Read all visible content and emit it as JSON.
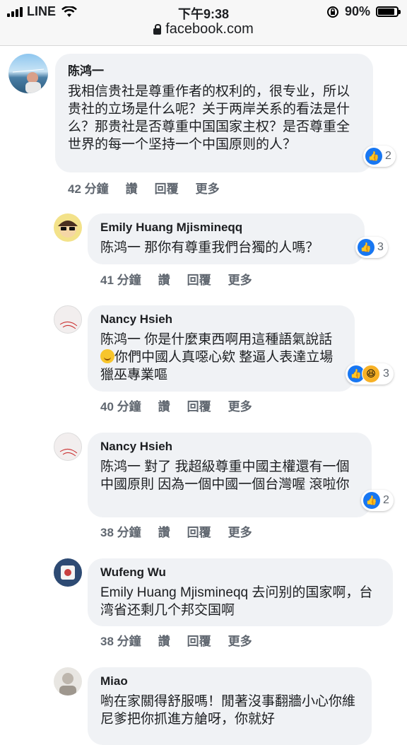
{
  "status_bar": {
    "carrier": "LINE",
    "time": "下午9:38",
    "battery": "90%",
    "battery_level": 0.9,
    "url": "facebook.com"
  },
  "comments": [
    {
      "name": "陈鸿一",
      "text": "我相信贵社是尊重作者的权利的，很专业，所以贵社的立场是什么呢？关于两岸关系的看法是什么？那贵社是否尊重中国国家主权？是否尊重全世界的每一个坚持一个中国原则的人？",
      "time": "42 分鐘",
      "actions": [
        "讚",
        "回覆",
        "更多"
      ],
      "reaction_count": "2"
    },
    {
      "name": "Emily Huang Mjismineqq",
      "text": "陈鸿一 那你有尊重我們台獨的人嗎？",
      "time": "41 分鐘",
      "actions": [
        "讚",
        "回覆",
        "更多"
      ],
      "reaction_count": "3"
    },
    {
      "name": "Nancy Hsieh",
      "text_before": "陈鸿一 你是什麼東西啊用這種語氣說話",
      "text_after": "你們中國人真噁心欸 整逼人表達立場 獵巫專業嘔",
      "time": "40 分鐘",
      "actions": [
        "讚",
        "回覆",
        "更多"
      ],
      "reaction_count": "3"
    },
    {
      "name": "Nancy Hsieh",
      "text": "陈鸿一 對了 我超級尊重中國主權還有一個中國原則 因為一個中國一個台灣喔 滾啦你",
      "time": "38 分鐘",
      "actions": [
        "讚",
        "回覆",
        "更多"
      ],
      "reaction_count": "2"
    },
    {
      "name": "Wufeng Wu",
      "text": "Emily Huang Mjismineqq 去问别的国家啊，台湾省还剩几个邦交国啊",
      "time": "38 分鐘",
      "actions": [
        "讚",
        "回覆",
        "更多"
      ]
    },
    {
      "name": "Miao",
      "text": "喲在家關得舒服嗎！閒著沒事翻牆小心你維尼爹把你抓進方艙呀，你就好"
    }
  ]
}
